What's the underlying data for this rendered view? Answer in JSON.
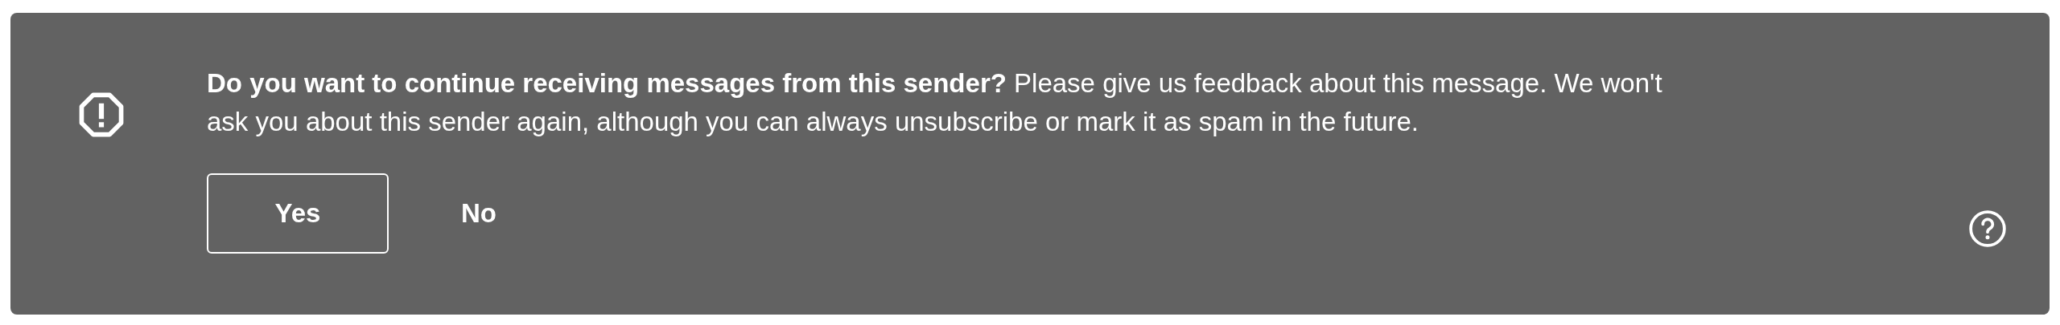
{
  "banner": {
    "message": "**Do you want to continue receiving messages from this sender?** Please give us feedback about this message. We won't ask you about this sender again, although you can always unsubscribe or mark it as spam in the future.",
    "buttons": [
      {
        "label": "Yes",
        "kind": "outlined"
      },
      {
        "label": "No",
        "kind": "text"
      }
    ]
  }
}
